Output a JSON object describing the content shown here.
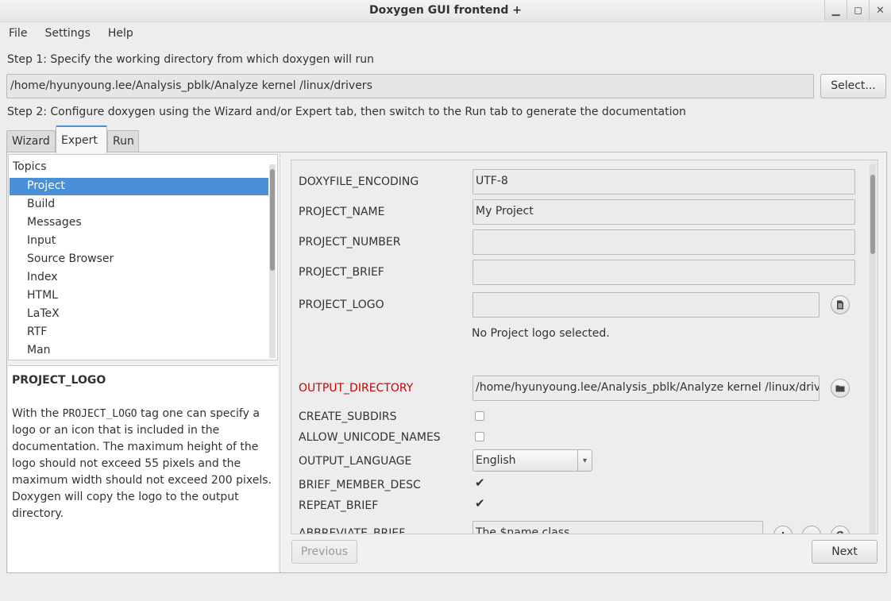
{
  "window": {
    "title": "Doxygen GUI frontend +"
  },
  "window_buttons": {
    "minimize": "▁",
    "maximize": "◻",
    "close": "✕"
  },
  "menu": [
    "File",
    "Settings",
    "Help"
  ],
  "step1": {
    "text": "Step 1: Specify the working directory from which doxygen will run",
    "directory": "/home/hyunyoung.lee/Analysis_pblk/Analyze kernel /linux/drivers",
    "select_label": "Select..."
  },
  "step2": {
    "text": "Step 2: Configure doxygen using the Wizard and/or Expert tab, then switch to the Run tab to generate the documentation"
  },
  "tabs": [
    "Wizard",
    "Expert",
    "Run"
  ],
  "topics": {
    "header": "Topics",
    "items": [
      "Project",
      "Build",
      "Messages",
      "Input",
      "Source Browser",
      "Index",
      "HTML",
      "LaTeX",
      "RTF",
      "Man"
    ]
  },
  "description": {
    "title": "PROJECT_LOGO",
    "before_tag": "With the ",
    "tag": "PROJECT_LOGO",
    "after_tag": " tag one can specify a logo or an icon that is included in the documentation. The maximum height of the logo should not exceed 55 pixels and the maximum width should not exceed 200 pixels. Doxygen will copy the logo to the output directory."
  },
  "form": {
    "doxyfile_encoding": {
      "label": "DOXYFILE_ENCODING",
      "value": "UTF-8"
    },
    "project_name": {
      "label": "PROJECT_NAME",
      "value": "My Project"
    },
    "project_number": {
      "label": "PROJECT_NUMBER",
      "value": ""
    },
    "project_brief": {
      "label": "PROJECT_BRIEF",
      "value": ""
    },
    "project_logo": {
      "label": "PROJECT_LOGO",
      "value": "",
      "note": "No Project logo selected."
    },
    "output_directory": {
      "label": "OUTPUT_DIRECTORY",
      "value": "/home/hyunyoung.lee/Analysis_pblk/Analyze kernel /linux/drivers"
    },
    "create_subdirs": {
      "label": "CREATE_SUBDIRS",
      "checked": false
    },
    "allow_unicode_names": {
      "label": "ALLOW_UNICODE_NAMES",
      "checked": false
    },
    "output_language": {
      "label": "OUTPUT_LANGUAGE",
      "value": "English"
    },
    "brief_member_desc": {
      "label": "BRIEF_MEMBER_DESC",
      "checked": true
    },
    "repeat_brief": {
      "label": "REPEAT_BRIEF",
      "checked": true
    },
    "abbreviate_brief": {
      "label": "ABBREVIATE_BRIEF",
      "value": "The $name class"
    }
  },
  "icons": {
    "file": "file-icon",
    "folder": "folder-icon",
    "add": "plus-icon",
    "remove": "minus-icon",
    "refresh": "refresh-icon",
    "check": "✔",
    "dropdown": "▾"
  },
  "nav": {
    "previous": "Previous",
    "next": "Next"
  },
  "colors": {
    "selection": "#4a90d9",
    "required_label": "#cc0000"
  }
}
